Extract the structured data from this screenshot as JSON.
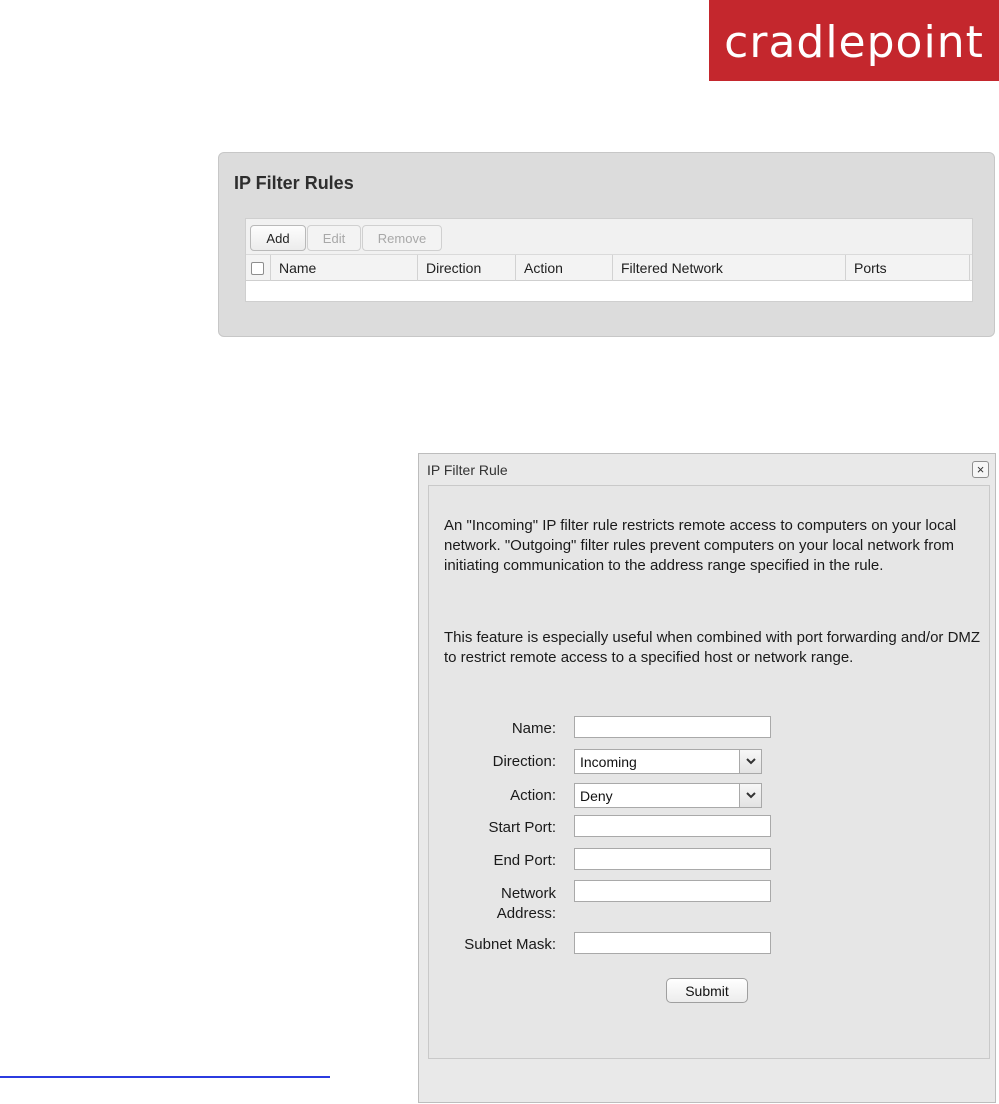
{
  "brand": {
    "logo_text": "cradlepoint",
    "color": "#c4272d"
  },
  "rules_panel": {
    "title": "IP Filter Rules",
    "toolbar": {
      "add": "Add",
      "edit": "Edit",
      "remove": "Remove"
    },
    "columns": [
      "Name",
      "Direction",
      "Action",
      "Filtered Network",
      "Ports"
    ],
    "rows": []
  },
  "dialog": {
    "title": "IP Filter Rule",
    "close": "×",
    "description_1": "An \"Incoming\" IP filter rule restricts remote access to computers on your local network. \"Outgoing\" filter rules prevent computers on your local network from initiating communication to the address range specified in the rule.",
    "description_2": "This feature is especially useful when combined with port forwarding and/or DMZ to restrict remote access to a specified host or network range.",
    "fields": {
      "name": {
        "label": "Name:",
        "value": ""
      },
      "direction": {
        "label": "Direction:",
        "value": "Incoming"
      },
      "action": {
        "label": "Action:",
        "value": "Deny"
      },
      "start_port": {
        "label": "Start Port:",
        "value": ""
      },
      "end_port": {
        "label": "End Port:",
        "value": ""
      },
      "network_address": {
        "label_line1": "Network",
        "label_line2": "Address:",
        "value": ""
      },
      "subnet_mask": {
        "label": "Subnet Mask:",
        "value": ""
      }
    },
    "submit": "Submit"
  }
}
